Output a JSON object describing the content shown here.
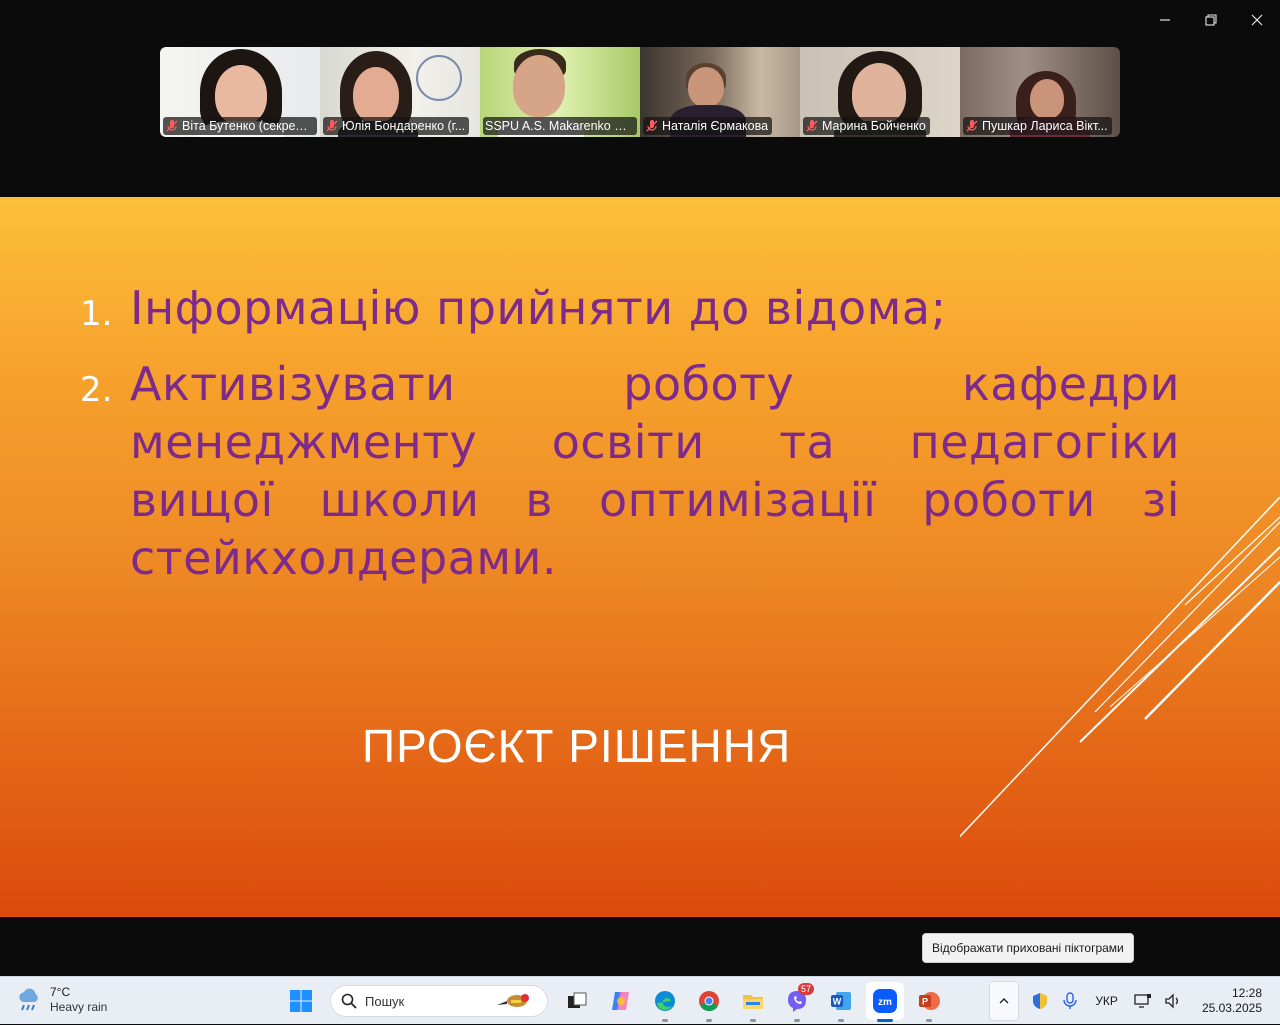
{
  "window": {
    "minimize_glyph": "—",
    "maximize_glyph": "❐",
    "close_glyph": "✕"
  },
  "participants": [
    {
      "name": "Віта Бутенко (секрета...",
      "muted": true,
      "active": false
    },
    {
      "name": "Юлія Бондаренко (г...",
      "muted": true,
      "active": false
    },
    {
      "name": "SSPU A.S. Makarenko Se...",
      "muted": false,
      "active": true
    },
    {
      "name": "Наталія  Єрмакова",
      "muted": true,
      "active": false
    },
    {
      "name": "Марина Бойченко",
      "muted": true,
      "active": false
    },
    {
      "name": "Пушкар Лариса Вікт...",
      "muted": true,
      "active": false
    }
  ],
  "slide": {
    "items": [
      {
        "number": "1.",
        "text": "Інформацію прийняти до відома;"
      },
      {
        "number": "2.",
        "text": "Активізувати роботу кафедри менеджменту освіти та педагогіки вищої школи в оптимізації роботи зі стейкхолдерами."
      }
    ],
    "title": "ПРОЄКТ РІШЕННЯ",
    "colors": {
      "text": "#7d2a8c",
      "gradient_top": "#fdbf3a",
      "gradient_bottom": "#dc4a0c"
    }
  },
  "tooltip": "Відображати приховані піктограми",
  "taskbar": {
    "weather": {
      "temp": "7°C",
      "condition": "Heavy rain"
    },
    "search_placeholder": "Пошук",
    "apps": [
      {
        "name": "start",
        "icon": "windows-logo-icon"
      },
      {
        "name": "task-view",
        "icon": "task-view-icon"
      },
      {
        "name": "copilot",
        "icon": "copilot-icon"
      },
      {
        "name": "edge",
        "icon": "edge-icon"
      },
      {
        "name": "chrome",
        "icon": "chrome-icon"
      },
      {
        "name": "file-explorer",
        "icon": "folder-icon"
      },
      {
        "name": "viber",
        "icon": "viber-icon",
        "badge": "57"
      },
      {
        "name": "word",
        "icon": "word-icon"
      },
      {
        "name": "zoom",
        "icon": "zoom-icon",
        "active": true
      },
      {
        "name": "powerpoint",
        "icon": "powerpoint-icon"
      }
    ],
    "tray": {
      "language": "УКР",
      "time": "12:28",
      "date": "25.03.2025"
    }
  }
}
